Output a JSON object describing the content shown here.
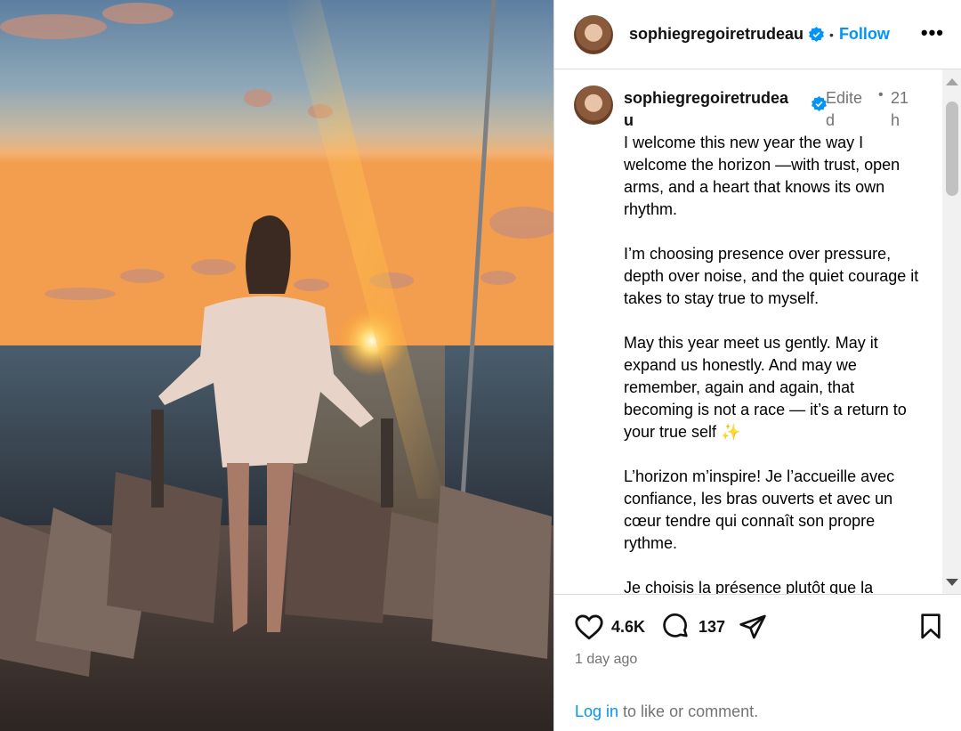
{
  "post": {
    "header": {
      "username": "sophiegregoiretrudeau",
      "separator": "•",
      "follow_label": "Follow",
      "more_label": "•••"
    },
    "caption": {
      "username": "sophiegregoiretrudeau",
      "edited": "Edited",
      "separator": "•",
      "time": "21h",
      "paragraphs": [
        "I welcome this new year the way I welcome the horizon —with trust, open arms, and a heart that knows its own rhythm.",
        "I’m choosing presence over pressure, depth over noise, and the quiet courage it takes to stay true to myself.",
        "May this year meet us gently. May it expand us honestly. And may we remember, again and again, that becoming is not a race — it’s a return to your true self ✨",
        "L’horizon m’inspire! Je l’accueille avec confiance, les bras ouverts et avec un cœur tendre qui connaît son propre rythme.",
        "Je choisis la présence plutôt que la"
      ]
    },
    "actions": {
      "likes": "4.6K",
      "comments": "137"
    },
    "time_ago": "1 day ago",
    "login_prompt": {
      "link": "Log in",
      "rest": " to like or comment."
    }
  },
  "colors": {
    "link_blue": "#0095f6",
    "muted_gray": "#737373",
    "verified_blue": "#0095f6"
  },
  "icons": [
    "verified-badge-icon",
    "heart-icon",
    "comment-icon",
    "share-icon",
    "bookmark-icon",
    "more-icon"
  ]
}
